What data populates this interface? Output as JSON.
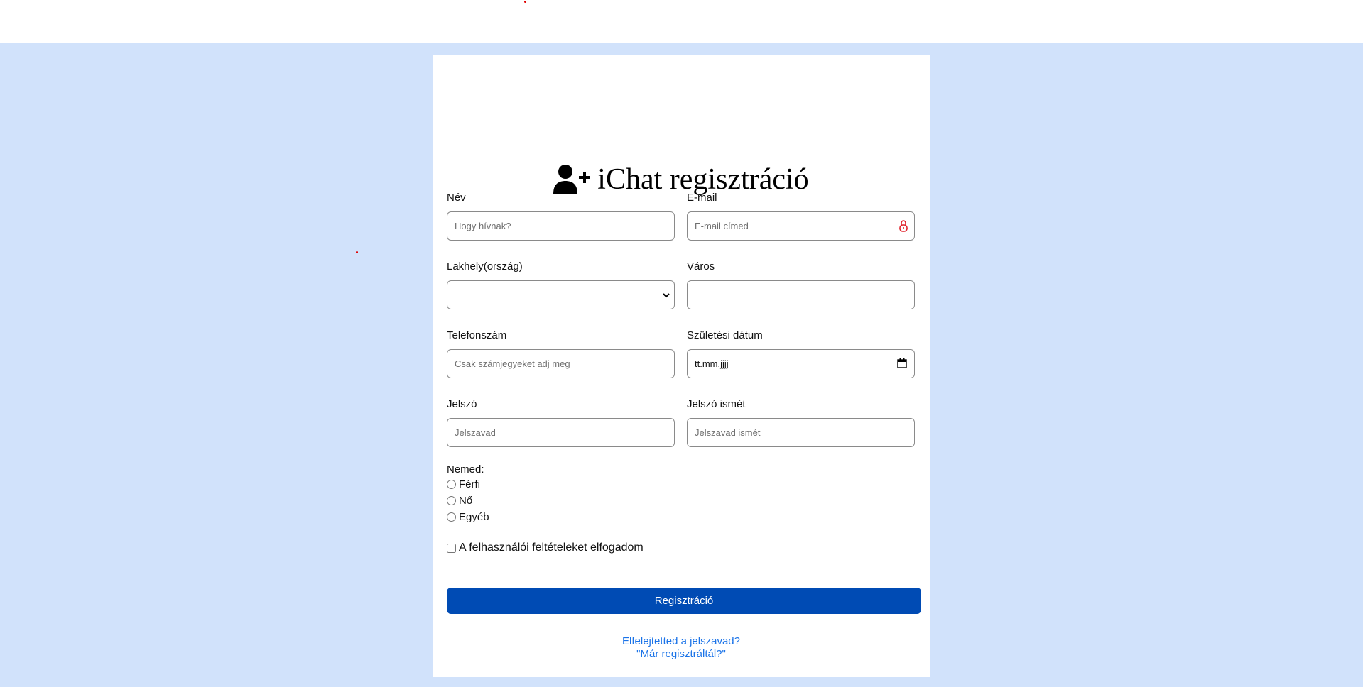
{
  "page": {
    "background_color": "#d1e2fb",
    "card_color": "#ffffff",
    "accent_color": "#004bb4",
    "link_color": "#1a73e8"
  },
  "header": {
    "title": "iChat regisztráció",
    "icon": "user-plus-icon"
  },
  "form": {
    "name": {
      "label": "Név",
      "placeholder": "Hogy hívnak?",
      "value": ""
    },
    "email": {
      "label": "E-mail",
      "placeholder": "E-mail címed",
      "value": "",
      "icon": "lock-icon"
    },
    "country": {
      "label": "Lakhely(ország)",
      "selected": ""
    },
    "city": {
      "label": "Város",
      "value": ""
    },
    "phone": {
      "label": "Telefonszám",
      "placeholder": "Csak számjegyeket adj meg",
      "value": ""
    },
    "birthdate": {
      "label": "Születési dátum",
      "display": "tt.mm.jjjj",
      "icon": "calendar-icon"
    },
    "password": {
      "label": "Jelszó",
      "placeholder": "Jelszavad",
      "value": ""
    },
    "password_repeat": {
      "label": "Jelszó ismét",
      "placeholder": "Jelszavad ismét",
      "value": ""
    },
    "gender": {
      "title": "Nemed:",
      "options": [
        "Férfi",
        "Nő",
        "Egyéb"
      ],
      "selected": null
    },
    "terms": {
      "label": "A felhasználói feltételeket elfogadom",
      "checked": false
    },
    "submit_label": "Regisztráció"
  },
  "links": {
    "forgot_password": "Elfelejtetted a jelszavad?",
    "already_registered": "\"Már regisztráltál?\""
  }
}
